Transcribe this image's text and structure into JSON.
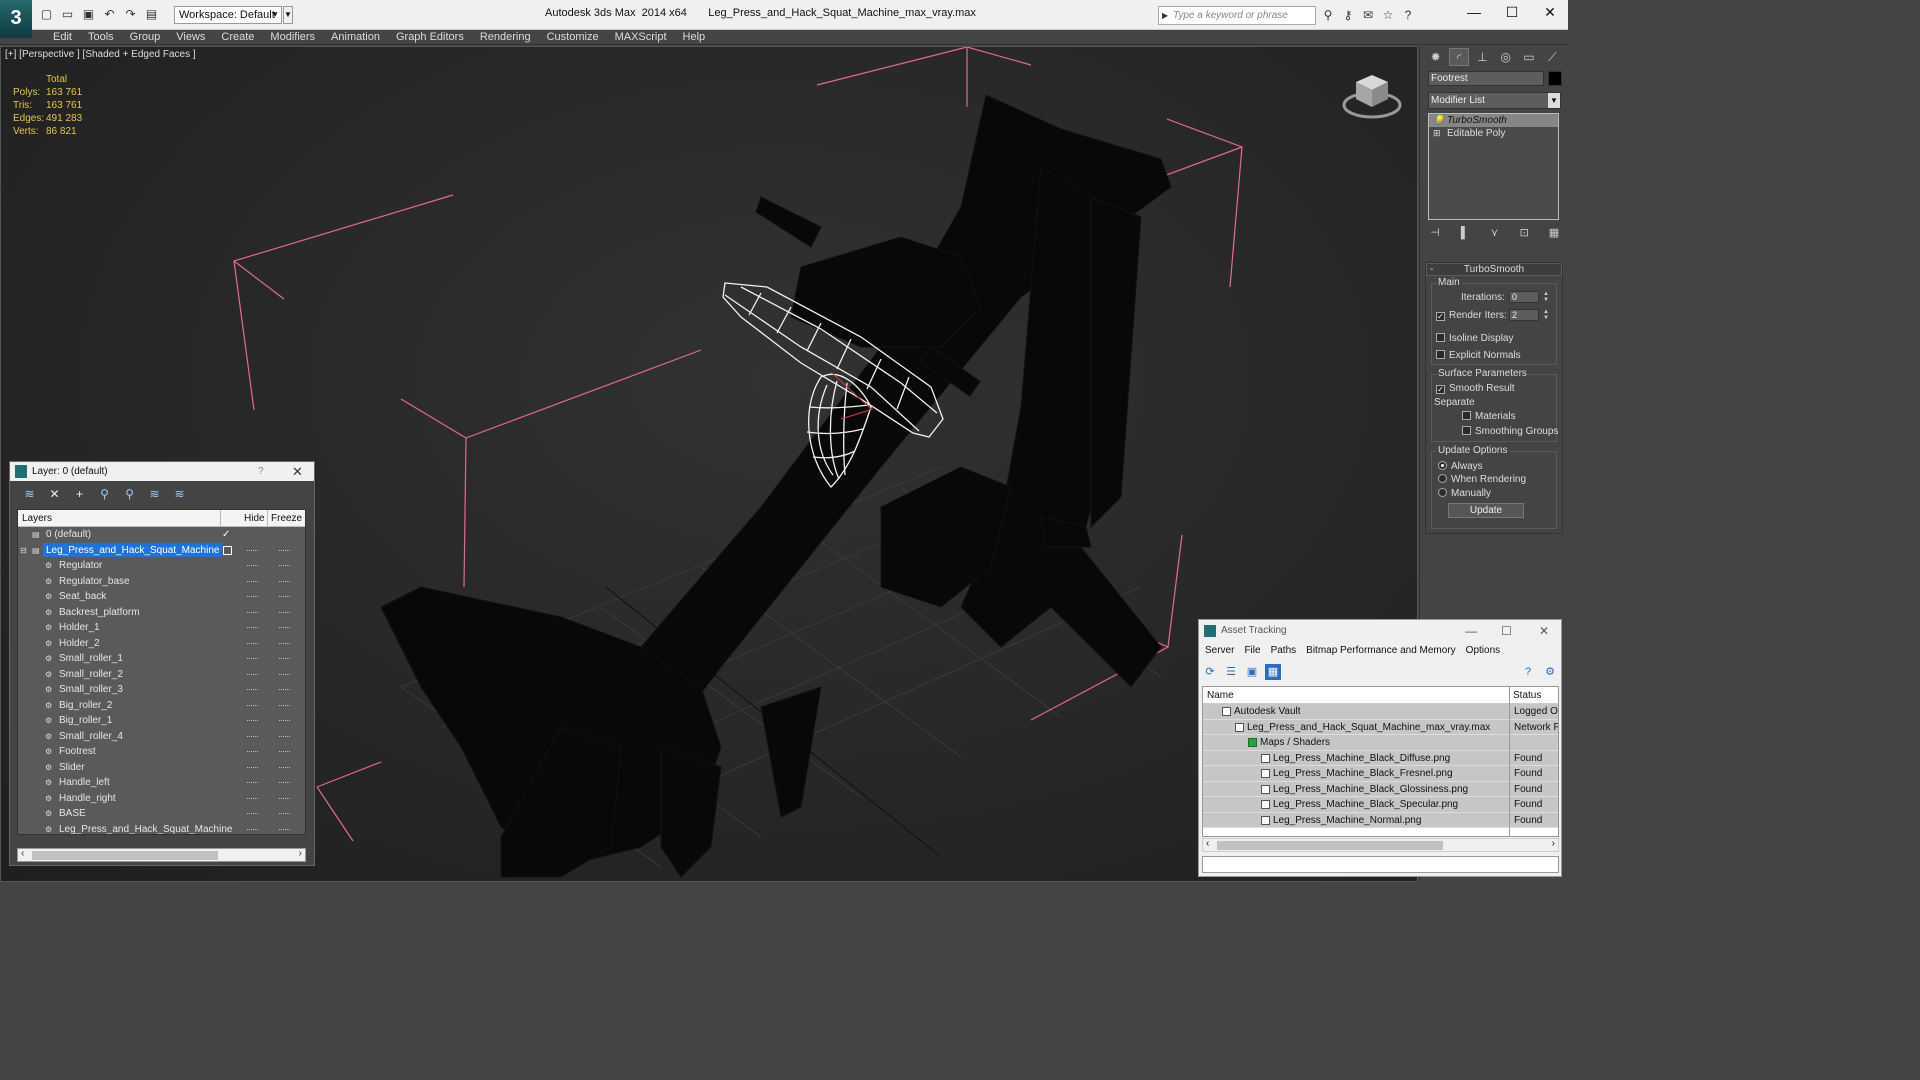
{
  "title_bar": {
    "app_title": "Autodesk 3ds Max  2014 x64       Leg_Press_and_Hack_Squat_Machine_max_vray.max",
    "workspace": "Workspace: Default",
    "search_placeholder": "Type a keyword or phrase"
  },
  "menu": [
    "Edit",
    "Tools",
    "Group",
    "Views",
    "Create",
    "Modifiers",
    "Animation",
    "Graph Editors",
    "Rendering",
    "Customize",
    "MAXScript",
    "Help"
  ],
  "viewport": {
    "label": "[+] [Perspective ] [Shaded + Edged Faces ]",
    "stats_header": "Total",
    "stats": [
      {
        "k": "Polys:",
        "v": "163 761"
      },
      {
        "k": "Tris:",
        "v": "163 761"
      },
      {
        "k": "Edges:",
        "v": "491 283"
      },
      {
        "k": "Verts:",
        "v": "86 821"
      }
    ]
  },
  "command_panel": {
    "object_name": "Footrest",
    "object_color": "#000000",
    "modifier_list": "Modifier List",
    "stack": [
      "TurboSmooth",
      "Editable Poly"
    ],
    "rollout_title": "TurboSmooth",
    "main_group": "Main",
    "iterations_label": "Iterations:",
    "iterations_value": "0",
    "render_iters_label": "Render Iters:",
    "render_iters_value": "2",
    "render_iters_checked": true,
    "isoline_display": "Isoline Display",
    "explicit_normals": "Explicit Normals",
    "surface_params": "Surface Parameters",
    "smooth_result": "Smooth Result",
    "separate": "Separate",
    "materials": "Materials",
    "smoothing_groups": "Smoothing Groups",
    "update_options": "Update Options",
    "always": "Always",
    "when_rendering": "When Rendering",
    "manually": "Manually",
    "update_button": "Update"
  },
  "layer_panel": {
    "title": "Layer: 0 (default)",
    "help": "?",
    "col_layers": "Layers",
    "col_hide": "Hide",
    "col_freeze": "Freeze",
    "layers": [
      {
        "name": "0 (default)",
        "level": 0,
        "current": true
      },
      {
        "name": "Leg_Press_and_Hack_Squat_Machine",
        "level": 0,
        "selected": true
      },
      {
        "name": "Regulator",
        "level": 1
      },
      {
        "name": "Regulator_base",
        "level": 1
      },
      {
        "name": "Seat_back",
        "level": 1
      },
      {
        "name": "Backrest_platform",
        "level": 1
      },
      {
        "name": "Holder_1",
        "level": 1
      },
      {
        "name": "Holder_2",
        "level": 1
      },
      {
        "name": "Small_roller_1",
        "level": 1
      },
      {
        "name": "Small_roller_2",
        "level": 1
      },
      {
        "name": "Small_roller_3",
        "level": 1
      },
      {
        "name": "Big_roller_2",
        "level": 1
      },
      {
        "name": "Big_roller_1",
        "level": 1
      },
      {
        "name": "Small_roller_4",
        "level": 1
      },
      {
        "name": "Footrest",
        "level": 1
      },
      {
        "name": "Slider",
        "level": 1
      },
      {
        "name": "Handle_left",
        "level": 1
      },
      {
        "name": "Handle_right",
        "level": 1
      },
      {
        "name": "BASE",
        "level": 1
      },
      {
        "name": "Leg_Press_and_Hack_Squat_Machine",
        "level": 1
      }
    ]
  },
  "asset_panel": {
    "title": "Asset Tracking",
    "menu": [
      "Server",
      "File",
      "Paths",
      "Bitmap Performance and Memory",
      "Options"
    ],
    "col_name": "Name",
    "col_status": "Status",
    "rows": [
      {
        "name": "Autodesk Vault",
        "level": 1,
        "status": "Logged Ou"
      },
      {
        "name": "Leg_Press_and_Hack_Squat_Machine_max_vray.max",
        "level": 2,
        "status": "Network Pa"
      },
      {
        "name": "Maps / Shaders",
        "level": 3,
        "status": ""
      },
      {
        "name": "Leg_Press_Machine_Black_Diffuse.png",
        "level": 4,
        "status": "Found"
      },
      {
        "name": "Leg_Press_Machine_Black_Fresnel.png",
        "level": 4,
        "status": "Found"
      },
      {
        "name": "Leg_Press_Machine_Black_Glossiness.png",
        "level": 4,
        "status": "Found"
      },
      {
        "name": "Leg_Press_Machine_Black_Specular.png",
        "level": 4,
        "status": "Found"
      },
      {
        "name": "Leg_Press_Machine_Normal.png",
        "level": 4,
        "status": "Found"
      }
    ]
  },
  "colors": {
    "selection_blue": "#1f73d8",
    "stats_yellow": "#e8c54a",
    "bbox_pink": "#e46a8c"
  }
}
